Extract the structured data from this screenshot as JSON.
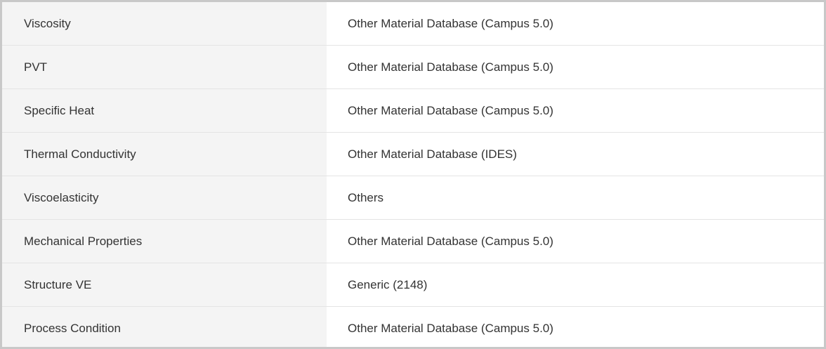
{
  "properties_table": {
    "rows": [
      {
        "label": "Viscosity",
        "value": "Other Material Database (Campus 5.0)"
      },
      {
        "label": "PVT",
        "value": "Other Material Database (Campus 5.0)"
      },
      {
        "label": "Specific Heat",
        "value": "Other Material Database (Campus 5.0)"
      },
      {
        "label": "Thermal Conductivity",
        "value": "Other Material Database (IDES)"
      },
      {
        "label": "Viscoelasticity",
        "value": "Others"
      },
      {
        "label": "Mechanical Properties",
        "value": "Other Material Database (Campus 5.0)"
      },
      {
        "label": "Structure VE",
        "value": "Generic (2148)"
      },
      {
        "label": "Process Condition",
        "value": "Other Material Database (Campus 5.0)"
      }
    ]
  },
  "colors": {
    "label_background": "#f4f4f4",
    "value_background": "#ffffff",
    "row_divider": "#e4e4e4",
    "frame_border": "#c8c8c8",
    "text": "#333333"
  }
}
